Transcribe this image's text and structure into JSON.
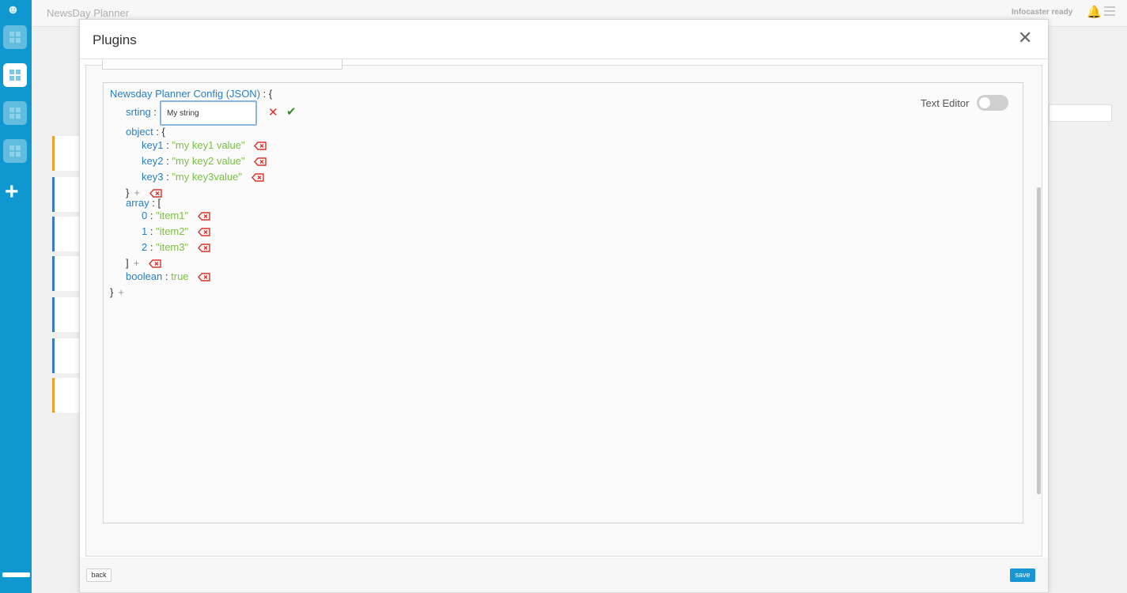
{
  "app": {
    "title": "NewsDay Planner",
    "status": "Infocaster ready"
  },
  "modal": {
    "title": "Plugins",
    "close_icon": "close-icon"
  },
  "editor": {
    "root_label": "Newsday Planner Config (JSON)",
    "string_key": "srting",
    "string_input_value": "My string",
    "object_key": "object",
    "object_items": [
      {
        "key": "key1",
        "value": "\"my key1 value\""
      },
      {
        "key": "key2",
        "value": "\"my key2 value\""
      },
      {
        "key": "key3",
        "value": "\"my key3value\""
      }
    ],
    "array_key": "array",
    "array_items": [
      {
        "index": "0",
        "value": "\"item1\""
      },
      {
        "index": "1",
        "value": "\"item2\""
      },
      {
        "index": "2",
        "value": "\"item3\""
      }
    ],
    "boolean_key": "boolean",
    "boolean_value": "true",
    "text_editor_label": "Text Editor",
    "text_editor_enabled": false
  },
  "footer": {
    "back_label": "back",
    "save_label": "save"
  },
  "colors": {
    "key": "#2a7fc4",
    "value": "#7ac043",
    "delete": "#d9322b",
    "save": "#1696d2",
    "sidebar": "#0f98cf"
  }
}
